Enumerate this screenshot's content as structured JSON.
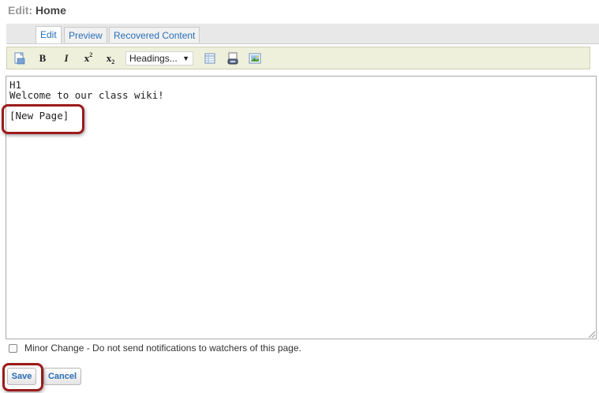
{
  "header": {
    "prefix": "Edit:",
    "page_name": "Home"
  },
  "tabs": [
    {
      "label": "Edit",
      "active": true
    },
    {
      "label": "Preview",
      "active": false
    },
    {
      "label": "Recovered Content",
      "active": false
    }
  ],
  "toolbar": {
    "bold_label": "B",
    "italic_label": "I",
    "sup_base": "x",
    "sup_mark": "2",
    "sub_base": "x",
    "sub_mark": "2",
    "headings_select": "Headings...",
    "icons": [
      "document-icon",
      "bold-icon",
      "italic-icon",
      "superscript-icon",
      "subscript-icon",
      "table-icon",
      "link-icon",
      "image-icon"
    ]
  },
  "editor": {
    "lines": [
      "H1",
      "Welcome to our class wiki!",
      "[New Page]"
    ]
  },
  "options": {
    "minor_change_label": "Minor Change - Do not send notifications to watchers of this page.",
    "minor_change_checked": false
  },
  "actions": {
    "save_label": "Save",
    "cancel_label": "Cancel"
  },
  "colors": {
    "link_blue": "#2a6eb5",
    "highlight_red": "#9c1a1a",
    "toolbar_bg": "#eef0db"
  }
}
